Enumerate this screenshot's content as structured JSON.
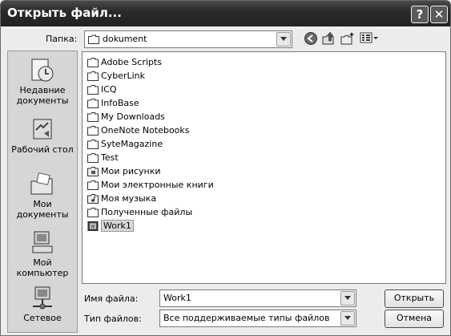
{
  "window": {
    "title": "Открыть файл..."
  },
  "titlebar": {
    "help_label": "?",
    "close_label": "✕"
  },
  "toolbar": {
    "folder_label": "Папка:",
    "folder_value": "dokument",
    "icons": [
      "back-icon",
      "up-folder-icon",
      "new-folder-icon",
      "views-menu-icon"
    ]
  },
  "places": [
    {
      "label": "Недавние документы",
      "icon": "recent-documents-icon"
    },
    {
      "label": "Рабочий стол",
      "icon": "desktop-icon"
    },
    {
      "label": "Мои документы",
      "icon": "my-documents-icon"
    },
    {
      "label": "Мой компьютер",
      "icon": "my-computer-icon"
    },
    {
      "label": "Сетевое",
      "icon": "network-icon"
    }
  ],
  "files": [
    {
      "name": "Adobe Scripts",
      "type": "folder"
    },
    {
      "name": "CyberLink",
      "type": "folder"
    },
    {
      "name": "ICQ",
      "type": "folder"
    },
    {
      "name": "InfoBase",
      "type": "folder"
    },
    {
      "name": "My Downloads",
      "type": "folder"
    },
    {
      "name": "OneNote Notebooks",
      "type": "folder"
    },
    {
      "name": "SyteMagazine",
      "type": "folder"
    },
    {
      "name": "Test",
      "type": "folder"
    },
    {
      "name": "Мои рисунки",
      "type": "folder"
    },
    {
      "name": "Мои электронные книги",
      "type": "folder"
    },
    {
      "name": "Моя музыка",
      "type": "folder"
    },
    {
      "name": "Полученные файлы",
      "type": "folder"
    },
    {
      "name": "Work1",
      "type": "document",
      "selected": true
    }
  ],
  "bottom": {
    "filename_label": "Имя файла:",
    "filename_value": "Work1",
    "filetype_label": "Тип файлов:",
    "filetype_value": "Все поддерживаемые типы файлов",
    "open_label": "Открыть",
    "cancel_label": "Отмена"
  }
}
